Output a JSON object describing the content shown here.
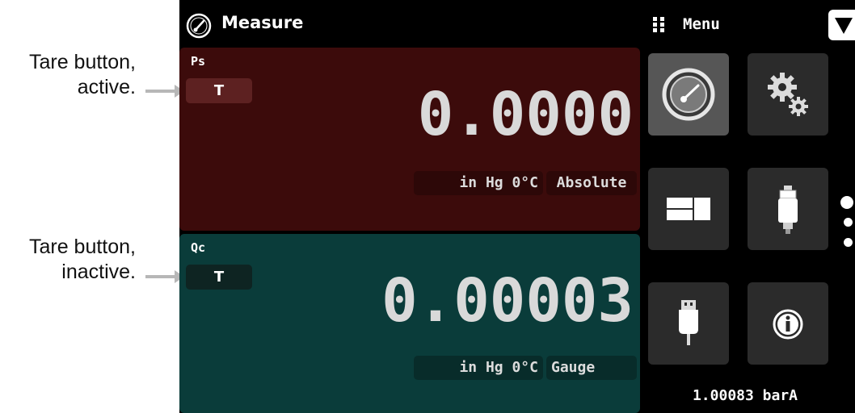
{
  "annotations": {
    "tare_active": "Tare button,\nactive.",
    "tare_inactive": "Tare button,\ninactive."
  },
  "header": {
    "title": "Measure",
    "icon": "gauge-icon",
    "menu_label": "Menu",
    "menu_icon": "grid-dots-icon",
    "dropdown_icon": "triangle-down-icon"
  },
  "channels": [
    {
      "name": "Ps",
      "tare_label": "T",
      "tare_state": "active",
      "value": "0.0000",
      "unit": "in Hg 0°C",
      "mode": "Absolute",
      "color": "#3c0b0b"
    },
    {
      "name": "Qc",
      "tare_label": "T",
      "tare_state": "inactive",
      "value": "0.00003",
      "unit": "in Hg 0°C",
      "mode": "Gauge",
      "color": "#0a3c3a"
    }
  ],
  "menu_tiles": [
    {
      "icon": "gauge-icon",
      "selected": true
    },
    {
      "icon": "gears-icon",
      "selected": false
    },
    {
      "icon": "window-layout-icon",
      "selected": false
    },
    {
      "icon": "sensor-icon",
      "selected": false
    },
    {
      "icon": "usb-icon",
      "selected": false
    },
    {
      "icon": "info-icon",
      "selected": false
    }
  ],
  "barometer": "1.00083 barA",
  "pagination": {
    "pages": 3,
    "current": 1
  }
}
